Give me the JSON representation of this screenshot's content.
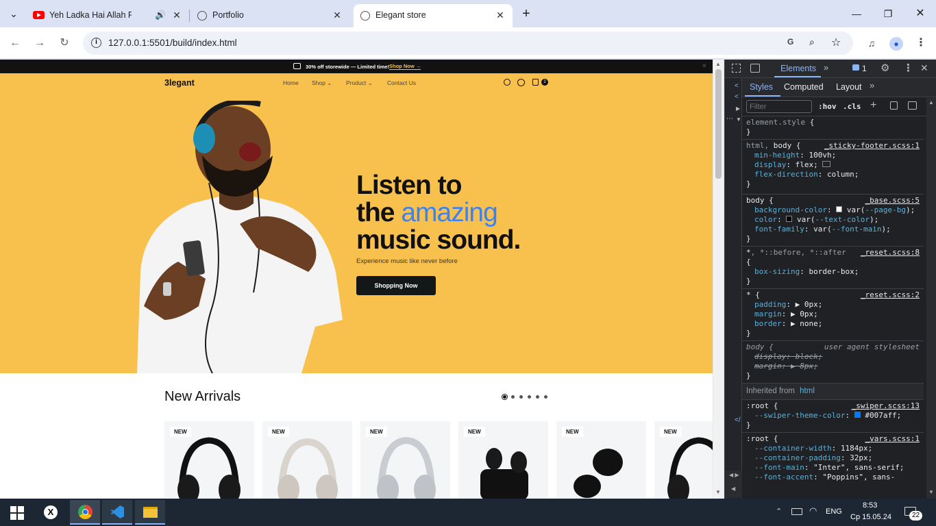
{
  "browser": {
    "tabs": [
      {
        "title": "Yeh Ladka Hai Allah Full Vid",
        "icon": "youtube-icon"
      },
      {
        "title": "Portfolio",
        "icon": "globe-icon"
      },
      {
        "title": "Elegant store",
        "icon": "globe-icon"
      }
    ],
    "url": "127.0.0.1:5501/build/index.html"
  },
  "site": {
    "promo_text": "30% off storewide — Limited time!",
    "promo_link": "Shop Now →",
    "logo": "3legant",
    "nav": [
      "Home",
      "Shop",
      "Product",
      "Contact Us"
    ],
    "cart_count": "2",
    "hero": {
      "line1": "Listen to",
      "line2a": "the ",
      "line2b": "amazing",
      "line3": "music sound.",
      "subtitle": "Experience music like never before",
      "cta": "Shopping Now"
    },
    "arrivals_title": "New Arrivals",
    "badge": "NEW"
  },
  "devtools": {
    "tabs": [
      "Elements"
    ],
    "issues_count": "1",
    "subtabs": [
      "Styles",
      "Computed",
      "Layout"
    ],
    "filter_placeholder": "Filter",
    "hov": ":hov",
    "cls": ".cls",
    "inherited_label": "Inherited from",
    "inherited_tag": "html"
  },
  "taskbar": {
    "lang": "ENG",
    "time": "8:53",
    "date": "Ср 15.05.24",
    "notif_count": "22"
  },
  "colors": {
    "hero_bg": "#f8c14d",
    "accent_blue": "#3b82f6",
    "swiper_theme": "#007aff"
  }
}
